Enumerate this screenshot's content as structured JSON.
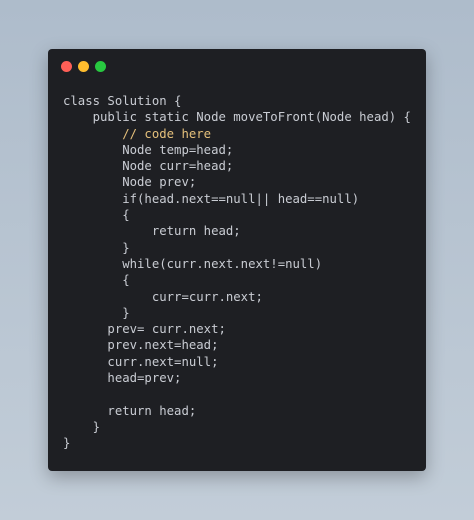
{
  "window": {
    "buttons": [
      "close",
      "minimize",
      "maximize"
    ]
  },
  "code_lines": [
    "class Solution {",
    "    public static Node moveToFront(Node head) {",
    "        // code here",
    "        Node temp=head;",
    "        Node curr=head;",
    "        Node prev;",
    "        if(head.next==null|| head==null)",
    "        {",
    "            return head;",
    "        }",
    "        while(curr.next.next!=null)",
    "        {",
    "            curr=curr.next;",
    "        }",
    "      prev= curr.next;",
    "      prev.next=head;",
    "      curr.next=null;",
    "      head=prev;",
    "",
    "      return head;",
    "    }",
    "}"
  ],
  "colors": {
    "background": "#1e1f23",
    "text": "#c9ccd3",
    "accent": "#e5c07b",
    "close": "#ff5f57",
    "minimize": "#febc2e",
    "maximize": "#28c840"
  }
}
